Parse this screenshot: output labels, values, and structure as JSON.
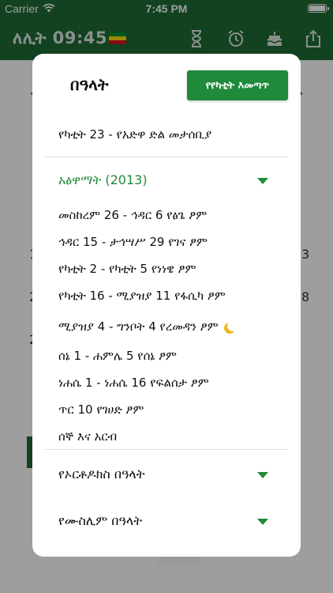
{
  "status_bar": {
    "carrier": "Carrier",
    "time": "7:45 PM"
  },
  "app_bar": {
    "clock": "ለሊት 09:45",
    "icons": [
      "ethiopian-flag-icon",
      "hourglass-icon",
      "alarm-clock-icon",
      "birthday-cake-icon",
      "share-icon"
    ]
  },
  "background": {
    "numbers": [
      "1",
      "2",
      "2",
      "3",
      "8"
    ]
  },
  "modal": {
    "title": "በዓላት",
    "action_label": "የየካቲት እመጣጥ",
    "featured": "የካቲት 23 - የአድዋ ድል መታሰቢያ",
    "sections": [
      {
        "title": "አፅዋማት (2013)",
        "expanded": true,
        "items": [
          "መስከረም 26 - ኅዳር 6 የፅጌ ፆም",
          "ኅዳር 15 - ታኅሣሥ 29 የገና ፆም",
          "የካቲት 2 - የካቲት 5 የነነዌ ፆም",
          "የካቲት 16 - ሚያዝያ 11 የፋሲካ ፆም",
          "ሚያዝያ 4 - ግንቦት 4 የረመዳን ፆም",
          "ሰኔ 1 - ሐምሌ 5 የሰኔ ፆም",
          "ነሐሴ 1 - ነሐሴ 16 የፍልሰታ ፆም",
          "ጥር 10 የገሀድ ፆም",
          "ሰኞ እና አርብ"
        ]
      },
      {
        "title": "የኦርቶዶክስ በዓላት",
        "expanded": false
      },
      {
        "title": "የሙስሊም በዓላት",
        "expanded": false
      }
    ]
  },
  "colors": {
    "brand_green": "#1e6b34",
    "accent_green": "#1e8a3a",
    "moon": "#e8b923"
  }
}
